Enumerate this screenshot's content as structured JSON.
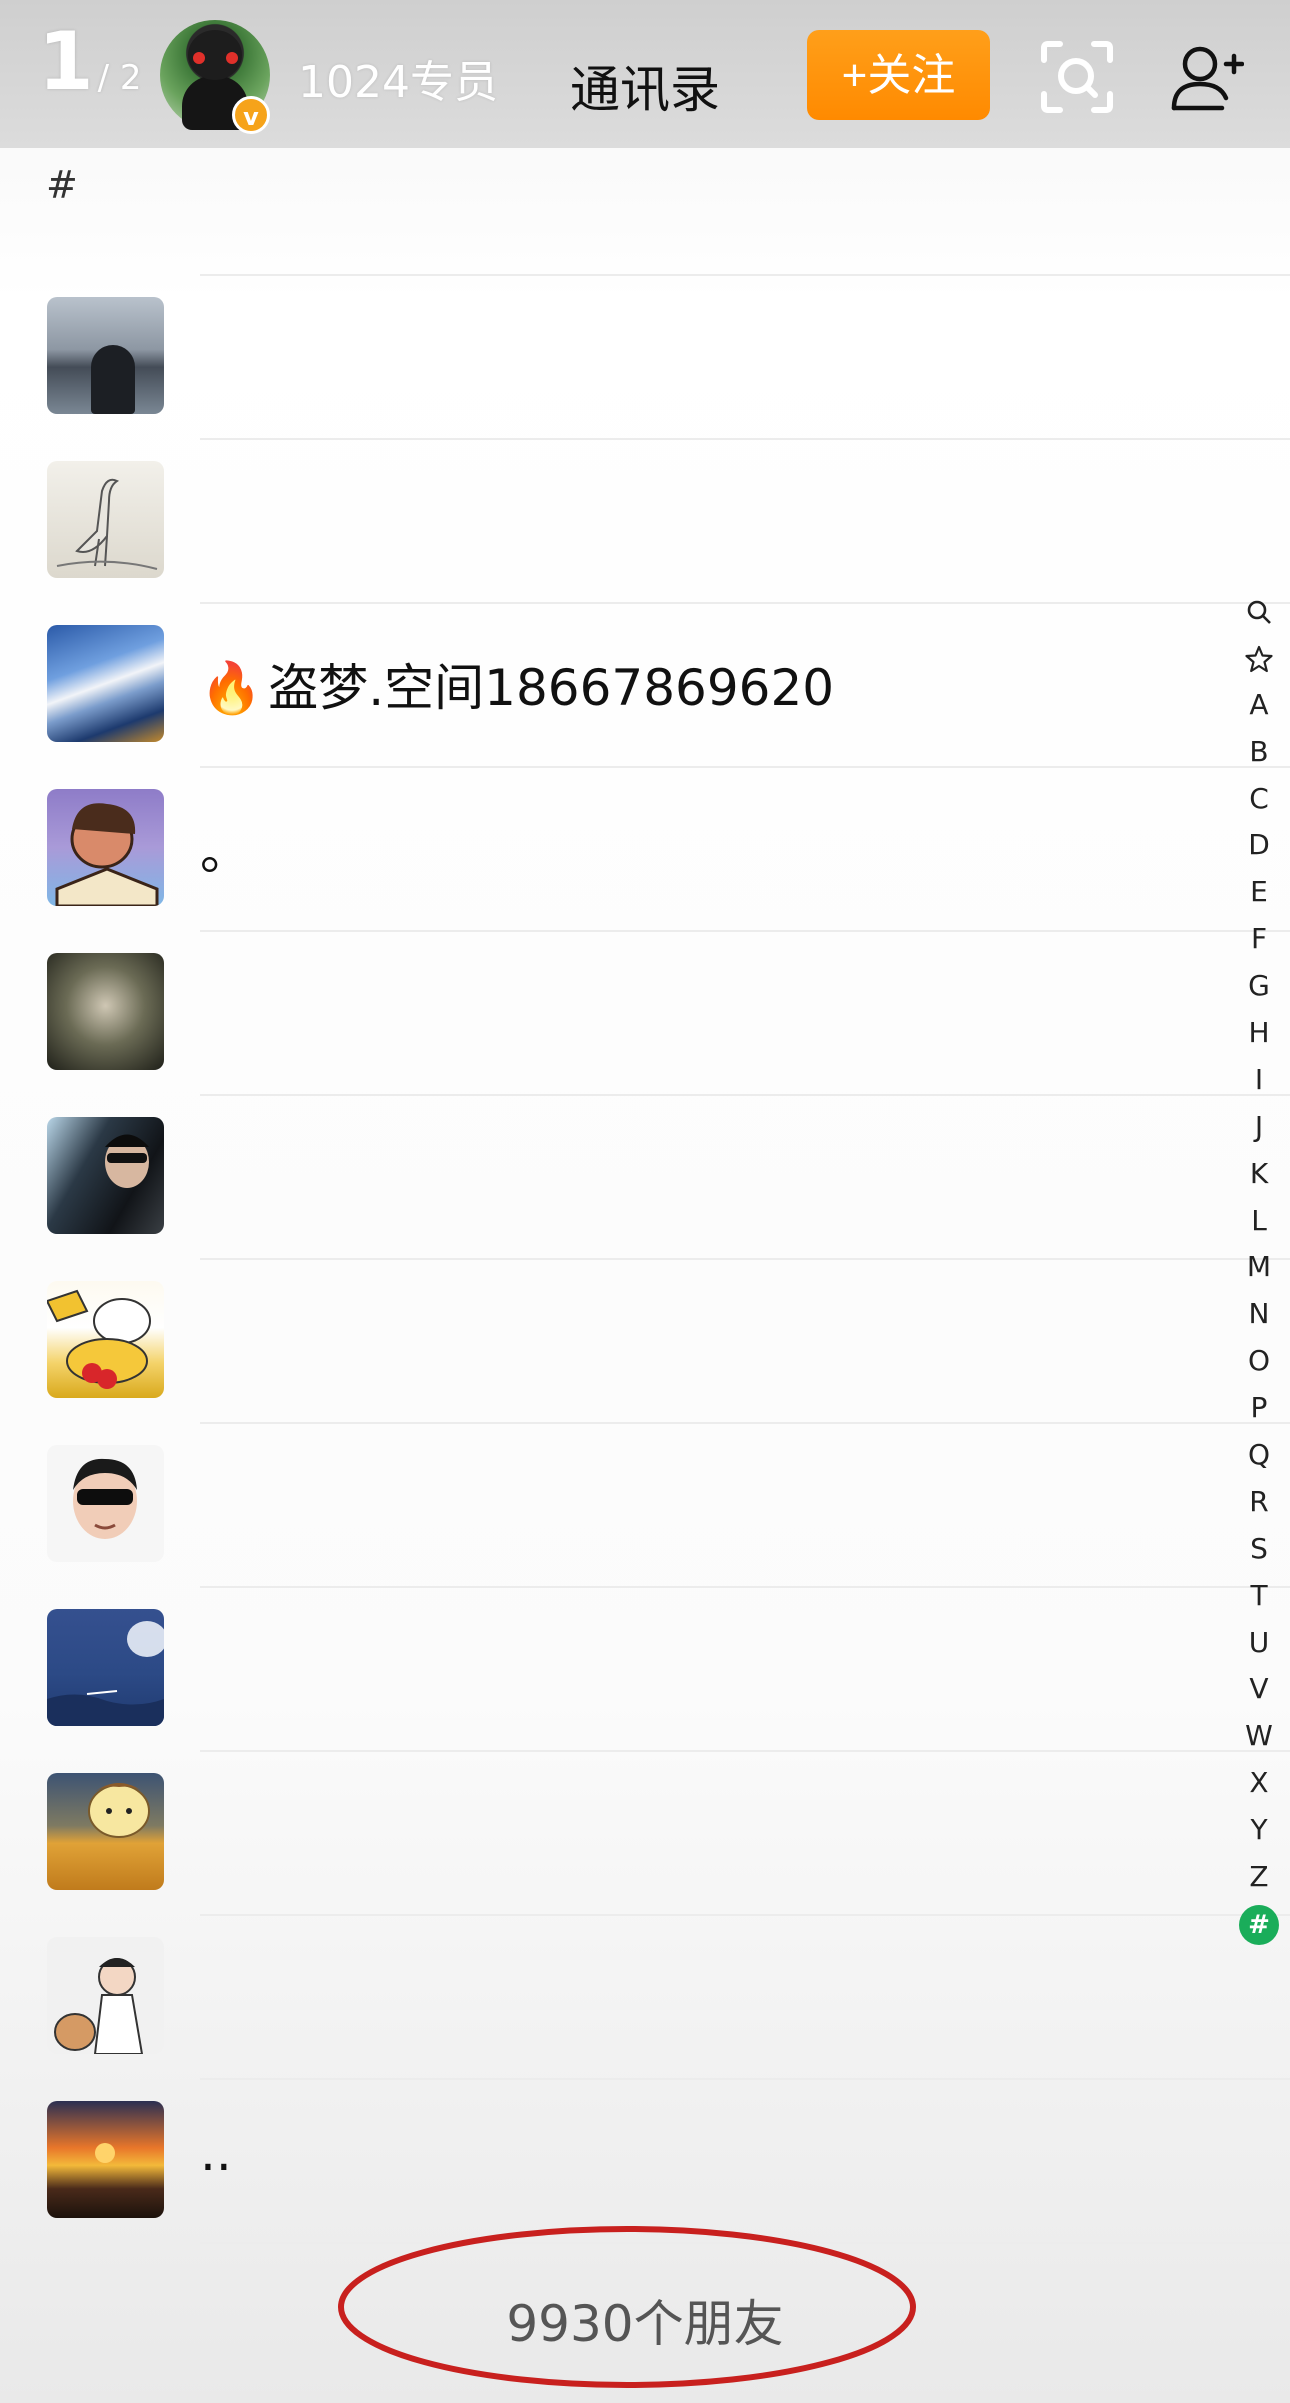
{
  "topbar": {
    "page_current": "1",
    "page_total": "/ 2",
    "username": "1024专员",
    "verified_badge": "v",
    "title": "通讯录",
    "follow_label": "+关注",
    "icons": [
      "scan-icon",
      "add-friend-icon"
    ]
  },
  "section_header": "#",
  "contacts": [
    {
      "name": "",
      "avatar": "person-by-lake"
    },
    {
      "name": "",
      "avatar": "heron-painting"
    },
    {
      "name": "盗梦.空间18667869620",
      "prefix_emoji": "🔥",
      "avatar": "cloud-sky"
    },
    {
      "name": "。",
      "avatar": "cartoon-man"
    },
    {
      "name": "",
      "avatar": "dark-texture"
    },
    {
      "name": "",
      "avatar": "sunglasses-photo"
    },
    {
      "name": "",
      "avatar": "cartoon-dog-cup"
    },
    {
      "name": "",
      "avatar": "man-sunglasses"
    },
    {
      "name": "",
      "avatar": "blue-sky"
    },
    {
      "name": "",
      "avatar": "pompompurin"
    },
    {
      "name": "",
      "avatar": "cartoon-boy"
    },
    {
      "name": "..",
      "avatar": "sunset"
    }
  ],
  "index_bar": [
    "search",
    "star",
    "A",
    "B",
    "C",
    "D",
    "E",
    "F",
    "G",
    "H",
    "I",
    "J",
    "K",
    "L",
    "M",
    "N",
    "O",
    "P",
    "Q",
    "R",
    "S",
    "T",
    "U",
    "V",
    "W",
    "X",
    "Y",
    "Z",
    "#"
  ],
  "index_active": "#",
  "footer": {
    "friend_count": "9930个朋友"
  },
  "colors": {
    "accent_orange": "#ff8a00",
    "index_active_green": "#1aad5a",
    "annotation_red": "#c8201e"
  }
}
